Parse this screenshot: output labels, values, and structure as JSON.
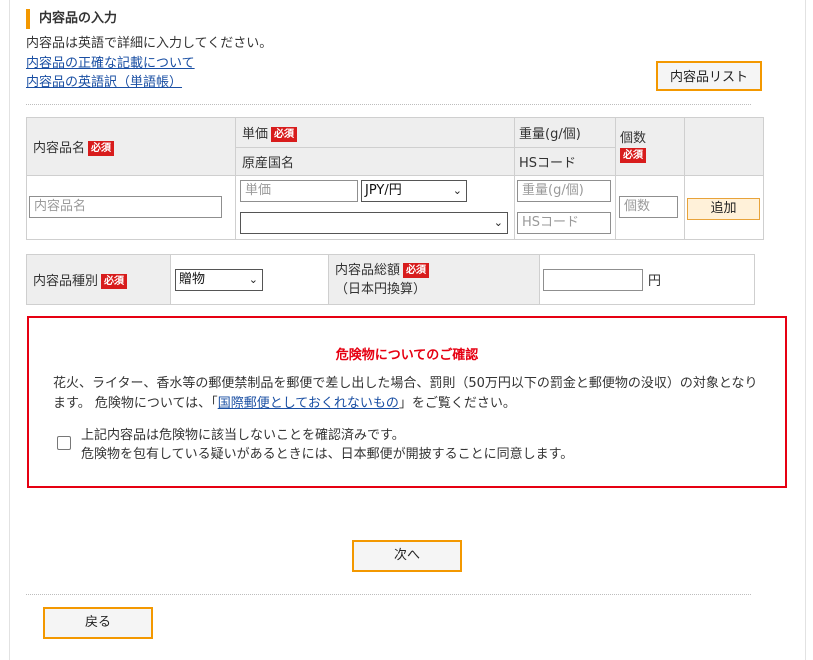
{
  "section": {
    "title": "内容品の入力",
    "description": "内容品は英語で詳細に入力してください。",
    "links": [
      "内容品の正確な記載について",
      "内容品の英語訳（単語帳）"
    ],
    "list_button": "内容品リスト"
  },
  "required_badge": "必須",
  "item_table": {
    "headers": {
      "name": "内容品名",
      "unit_price": "単価",
      "origin": "原産国名",
      "weight": "重量(g/個)",
      "hs_code": "HSコード",
      "quantity": "個数"
    },
    "inputs": {
      "name_placeholder": "内容品名",
      "unit_price_placeholder": "単価",
      "currency_selected": "JPY/円",
      "origin_selected": "",
      "weight_placeholder": "重量(g/個)",
      "hs_code_placeholder": "HSコード",
      "quantity_placeholder": "個数"
    },
    "add_button": "追加"
  },
  "category": {
    "label": "内容品種別",
    "selected": "贈物",
    "total_label": "内容品総額",
    "total_sub": "（日本円換算）",
    "total_value": "",
    "unit": "円"
  },
  "danger": {
    "title": "危険物についてのご確認",
    "body_1": "花火、ライター、香水等の郵便禁制品を郵便で差し出した場合、罰則（50万円以下の罰金と郵便物の没収）の対象となります。 危険物については、「",
    "body_link": "国際郵便としておくれないもの",
    "body_2": "」をご覧ください。",
    "checkbox_line1": "上記内容品は危険物に該当しないことを確認済みです。",
    "checkbox_line2": "危険物を包有している疑いがあるときには、日本郵便が開披することに同意します。",
    "checked": false
  },
  "nav": {
    "next": "次へ",
    "back": "戻る"
  },
  "colors": {
    "accent": "#f39800",
    "danger": "#e60012",
    "required_bg": "#d81c1c",
    "link": "#1a4fa3"
  }
}
